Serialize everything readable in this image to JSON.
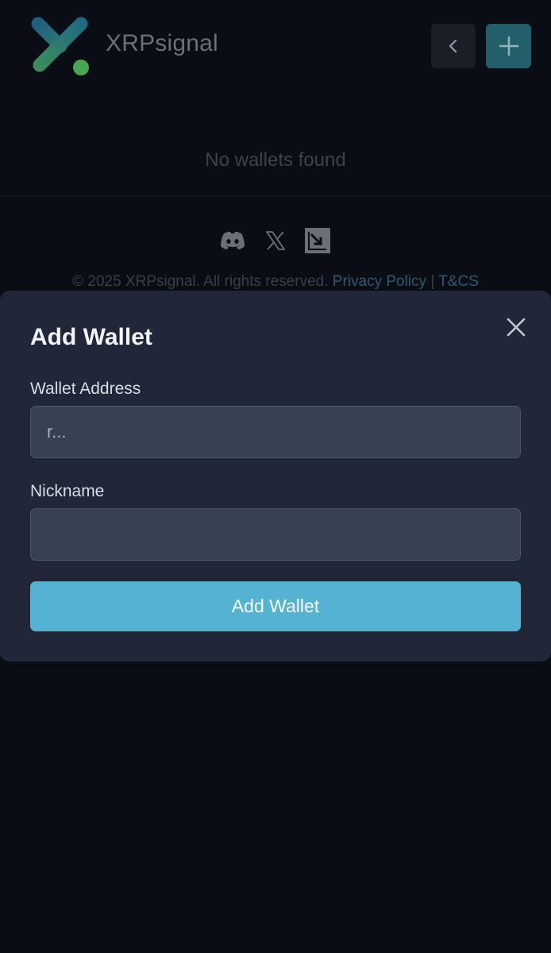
{
  "header": {
    "brand_name": "XRPsignal",
    "logo_icon": "xrpsignal-logo-icon",
    "back_icon": "chevron-left-icon",
    "add_icon": "plus-icon"
  },
  "main": {
    "empty_message": "No wallets found"
  },
  "footer": {
    "social_icons": [
      "discord-icon",
      "x-icon",
      "xrpl-icon"
    ],
    "copyright_text": "© 2025 XRPsignal. All rights reserved.",
    "privacy_link": "Privacy Policy",
    "separator": "|",
    "terms_link": "T&CS"
  },
  "modal": {
    "title": "Add Wallet",
    "close_icon": "close-icon",
    "address_label": "Wallet Address",
    "address_placeholder": "r...",
    "address_value": "",
    "nickname_label": "Nickname",
    "nickname_placeholder": "",
    "nickname_value": "",
    "submit_label": "Add Wallet"
  },
  "colors": {
    "background": "#0a0d14",
    "modal_background": "#1f2738",
    "accent": "#53b3d1",
    "header_add_button": "#21606b"
  }
}
